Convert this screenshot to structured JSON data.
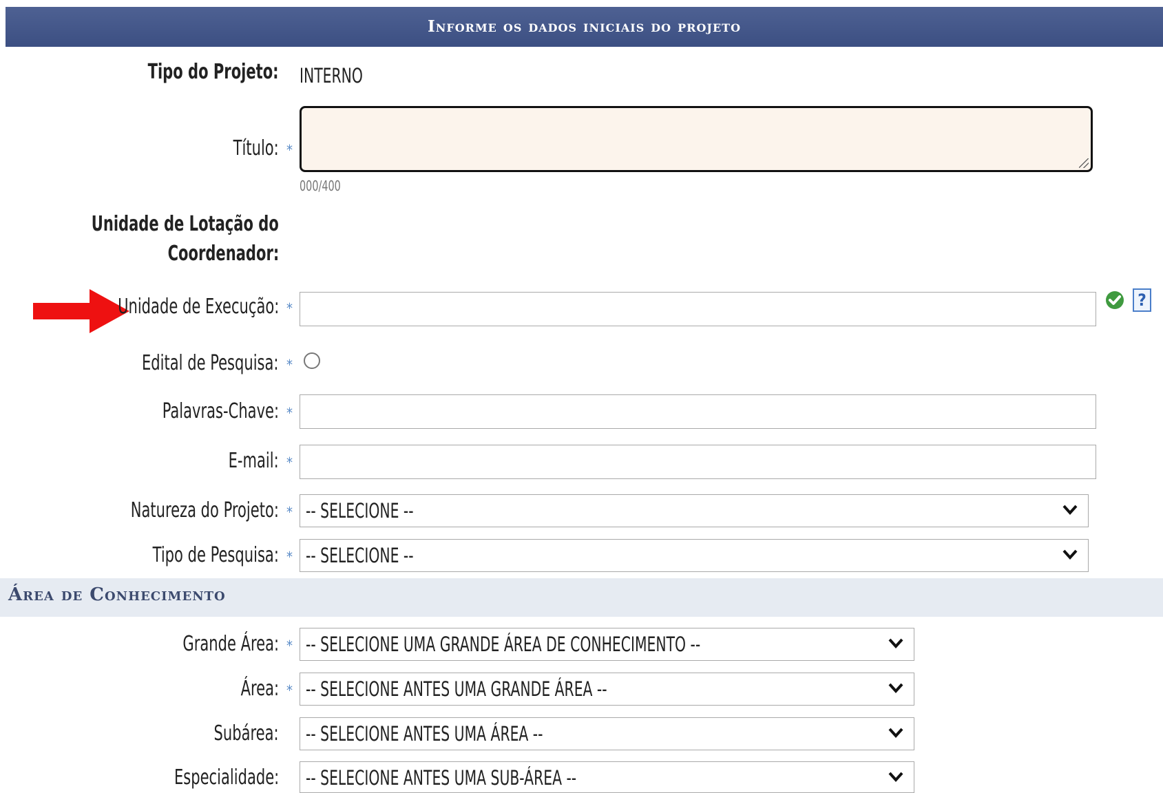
{
  "header": {
    "title": "Informe os dados iniciais do projeto"
  },
  "form": {
    "tipo_projeto": {
      "label": "Tipo do Projeto:",
      "value": "INTERNO"
    },
    "titulo": {
      "label": "Título:",
      "required": "*",
      "counter": "000/400"
    },
    "unidade_lotacao": {
      "label_line1": "Unidade de Lotação do",
      "label_line2": "Coordenador:"
    },
    "unidade_execucao": {
      "label": "Unidade de Execução:",
      "required": "*"
    },
    "edital": {
      "label": "Edital de Pesquisa:",
      "required": "*"
    },
    "palavras_chave": {
      "label": "Palavras-Chave:",
      "required": "*"
    },
    "email": {
      "label": "E-mail:",
      "required": "*"
    },
    "natureza": {
      "label": "Natureza do Projeto:",
      "required": "*",
      "selected": "-- SELECIONE --"
    },
    "tipo_pesquisa": {
      "label": "Tipo de Pesquisa:",
      "required": "*",
      "selected": "-- SELECIONE --"
    }
  },
  "area_conhecimento": {
    "title": "Área de Conhecimento",
    "grande_area": {
      "label": "Grande Área:",
      "required": "*",
      "selected": "-- SELECIONE UMA GRANDE ÁREA DE CONHECIMENTO --"
    },
    "area": {
      "label": "Área:",
      "required": "*",
      "selected": "-- SELECIONE ANTES UMA GRANDE ÁREA --"
    },
    "subarea": {
      "label": "Subárea:",
      "selected": "-- SELECIONE ANTES UMA ÁREA --"
    },
    "especialidade": {
      "label": "Especialidade:",
      "selected": "-- SELECIONE ANTES UMA SUB-ÁREA --"
    }
  },
  "icons": {
    "check": "check-icon",
    "help": "help-icon",
    "help_glyph": "?",
    "arrow": "red-arrow-icon",
    "arrow_color": "#ee1111",
    "header_color": "#3c4f82",
    "required_color": "#5a8bc7"
  }
}
